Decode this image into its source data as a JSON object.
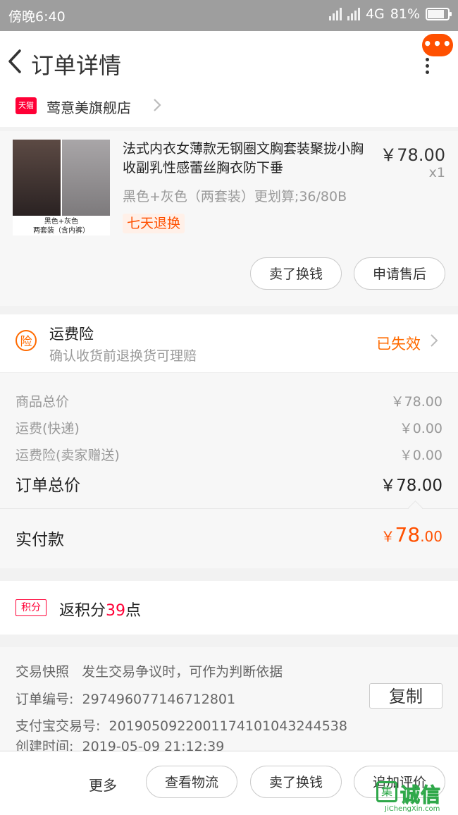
{
  "status_bar": {
    "time": "傍晚6:40",
    "network": "4G",
    "battery": "81%"
  },
  "navbar": {
    "title": "订单详情",
    "more_badge": "•••"
  },
  "store": {
    "platform_badge": "天猫",
    "name": "莺意美旗舰店"
  },
  "product": {
    "name": "法式内衣女薄款无钢圈文胸套装聚拢小胸收副乳性感蕾丝胸衣防下垂",
    "price": "￥78.00",
    "quantity": "x1",
    "spec": "黑色+灰色（两套装）更划算;36/80B",
    "tag": "七天退换",
    "image_caption_line1": "黑色+灰色",
    "image_caption_line2": "两套装（含内裤）",
    "buttons": {
      "sell": "卖了换钱",
      "after_sale": "申请售后"
    }
  },
  "insurance": {
    "icon_text": "险",
    "title": "运费险",
    "subtitle": "确认收货前退换货可理赔",
    "status": "已失效"
  },
  "price_breakdown": {
    "rows": [
      {
        "label": "商品总价",
        "value": "￥78.00"
      },
      {
        "label": "运费(快递)",
        "value": "￥0.00"
      },
      {
        "label": "运费险(卖家赠送)",
        "value": "￥0.00"
      }
    ],
    "total_label": "订单总价",
    "total_value": "￥78.00"
  },
  "paid": {
    "label": "实付款",
    "symbol": "￥",
    "integer": "78",
    "decimal": ".00"
  },
  "points": {
    "badge": "积分",
    "prefix": "返积分",
    "count": "39",
    "suffix": "点"
  },
  "order_info": {
    "snapshot_label": "交易快照",
    "snapshot_text": "发生交易争议时，可作为判断依据",
    "order_no_label": "订单编号:",
    "order_no": "297496077146712801",
    "copy_label": "复制",
    "alipay_label": "支付宝交易号:",
    "alipay_no": "2019050922001174101043244538",
    "created_label": "创建时间:",
    "created_time": "2019-05-09 21:12:39"
  },
  "bottom_bar": {
    "more": "更多",
    "logistics": "查看物流",
    "sell": "卖了换钱",
    "review": "追加评价"
  },
  "watermark": {
    "box_char": "集",
    "text": "诚信",
    "site": "JiChengXin.com"
  },
  "colors": {
    "accent": "#ff5000",
    "insurance": "#ff6a00",
    "tmall": "#ff0036"
  }
}
